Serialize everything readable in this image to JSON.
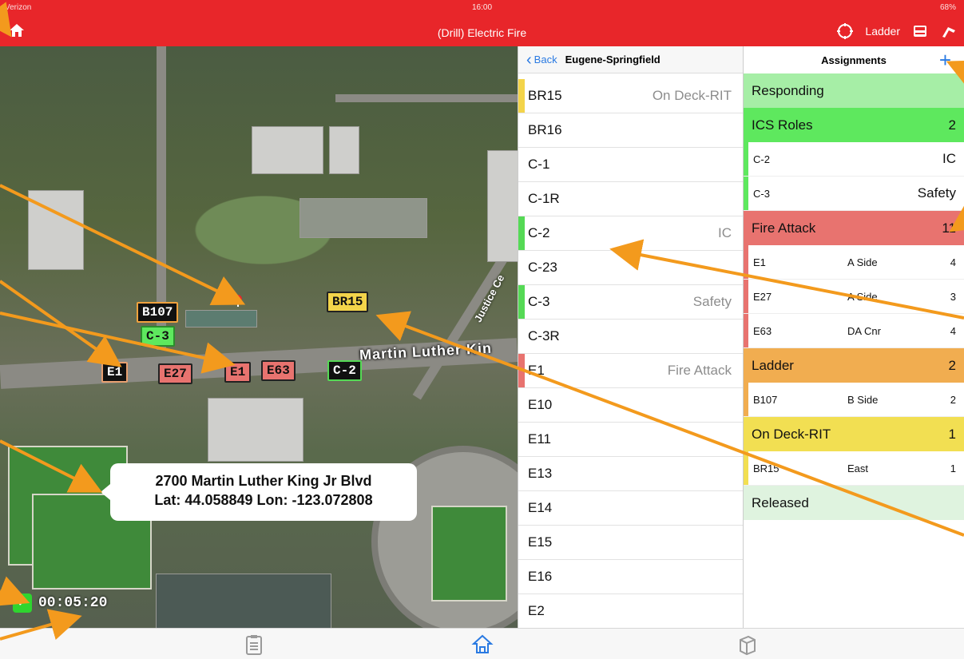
{
  "status": {
    "carrier": "Verizon",
    "time": "16:00",
    "battery": "68%"
  },
  "nav": {
    "title": "(Drill) Electric Fire",
    "ladder_label": "Ladder"
  },
  "map": {
    "street": "Martin Luther Kin",
    "street2": "Justice Ce",
    "address_line1": "2700 Martin Luther King Jr Blvd",
    "address_line2": "Lat: 44.058849 Lon: -123.072808",
    "timer": "00:05:20",
    "markers": [
      {
        "label": "B107",
        "style": "orange"
      },
      {
        "label": "C-3",
        "style": "green-light"
      },
      {
        "label": "BR15",
        "style": "yellow"
      },
      {
        "label": "E1",
        "style": "black"
      },
      {
        "label": "E27",
        "style": "red"
      },
      {
        "label": "E1",
        "style": "red"
      },
      {
        "label": "E63",
        "style": "red"
      },
      {
        "label": "C-2",
        "style": "green"
      }
    ]
  },
  "units_panel": {
    "back": "Back",
    "region": "Eugene-Springfield",
    "items": [
      {
        "name": "BR15",
        "assignment": "On Deck-RIT",
        "color": "#f3d44a"
      },
      {
        "name": "BR16",
        "assignment": "",
        "color": ""
      },
      {
        "name": "C-1",
        "assignment": "",
        "color": ""
      },
      {
        "name": "C-1R",
        "assignment": "",
        "color": ""
      },
      {
        "name": "C-2",
        "assignment": "IC",
        "color": "#55d955"
      },
      {
        "name": "C-23",
        "assignment": "",
        "color": ""
      },
      {
        "name": "C-3",
        "assignment": "Safety",
        "color": "#55d955"
      },
      {
        "name": "C-3R",
        "assignment": "",
        "color": ""
      },
      {
        "name": "E1",
        "assignment": "Fire Attack",
        "color": "#e8736f"
      },
      {
        "name": "E10",
        "assignment": "",
        "color": ""
      },
      {
        "name": "E11",
        "assignment": "",
        "color": ""
      },
      {
        "name": "E13",
        "assignment": "",
        "color": ""
      },
      {
        "name": "E14",
        "assignment": "",
        "color": ""
      },
      {
        "name": "E15",
        "assignment": "",
        "color": ""
      },
      {
        "name": "E16",
        "assignment": "",
        "color": ""
      },
      {
        "name": "E2",
        "assignment": "",
        "color": ""
      }
    ]
  },
  "assignments": {
    "title": "Assignments",
    "add": "+",
    "groups": {
      "responding": {
        "label": "Responding",
        "color": "#a6eea6"
      },
      "ics": {
        "label": "ICS Roles",
        "count": "2",
        "color": "#5ee85e",
        "rows": [
          {
            "unit": "C-2",
            "role": "IC"
          },
          {
            "unit": "C-3",
            "role": "Safety"
          }
        ]
      },
      "fire": {
        "label": "Fire Attack",
        "count": "11",
        "color": "#e8736f",
        "rows": [
          {
            "unit": "E1",
            "loc": "A Side",
            "n": "4"
          },
          {
            "unit": "E27",
            "loc": "A Side",
            "n": "3"
          },
          {
            "unit": "E63",
            "loc": "DA Cnr",
            "n": "4"
          }
        ]
      },
      "ladder": {
        "label": "Ladder",
        "count": "2",
        "color": "#f1ad50",
        "rows": [
          {
            "unit": "B107",
            "loc": "B Side",
            "n": "2"
          }
        ]
      },
      "ondeck": {
        "label": "On Deck-RIT",
        "count": "1",
        "color": "#f2df52",
        "rows": [
          {
            "unit": "BR15",
            "loc": "East",
            "n": "1"
          }
        ]
      },
      "released": {
        "label": "Released",
        "color": "#dff3df"
      }
    }
  },
  "colors": {
    "accent": "#e8262a",
    "link": "#2a7ae2",
    "annotation": "#f39a1d"
  }
}
